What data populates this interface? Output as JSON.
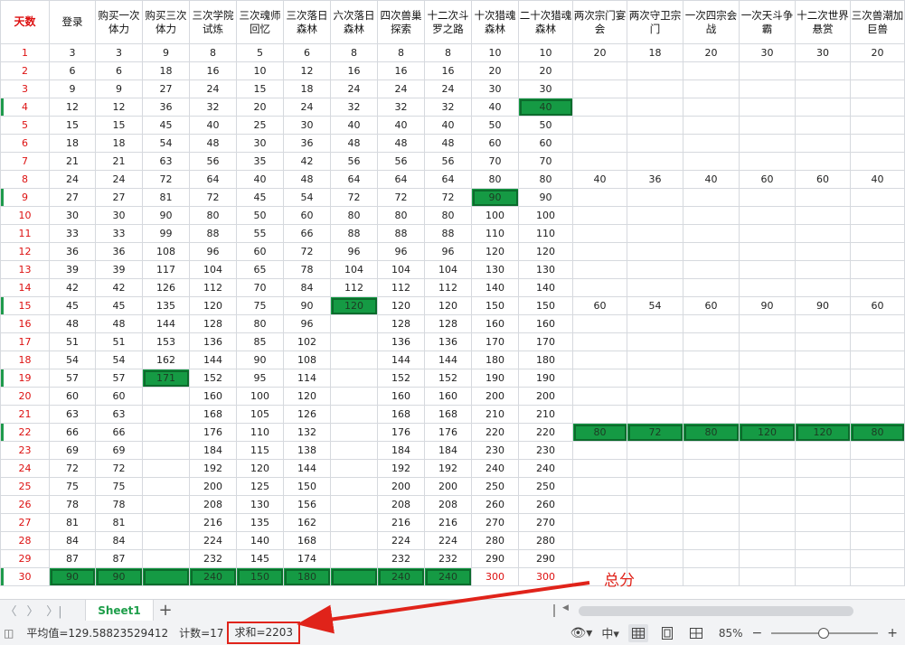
{
  "sheet": {
    "headers": [
      "天数",
      "登录",
      "购买一次体力",
      "购买三次体力",
      "三次学院试炼",
      "三次魂师回忆",
      "三次落日森林",
      "六次落日森林",
      "四次兽巢探索",
      "十二次斗罗之路",
      "十次猎魂森林",
      "二十次猎魂森林",
      "两次宗门宴会",
      "两次守卫宗门",
      "一次四宗会战",
      "一次天斗争霸",
      "十二次世界悬赏",
      "三次兽潮加巨兽"
    ],
    "rows": [
      [
        "1",
        "3",
        "3",
        "9",
        "8",
        "5",
        "6",
        "8",
        "8",
        "8",
        "10",
        "10",
        "20",
        "18",
        "20",
        "30",
        "30",
        "20"
      ],
      [
        "2",
        "6",
        "6",
        "18",
        "16",
        "10",
        "12",
        "16",
        "16",
        "16",
        "20",
        "20",
        "",
        "",
        "",
        "",
        "",
        ""
      ],
      [
        "3",
        "9",
        "9",
        "27",
        "24",
        "15",
        "18",
        "24",
        "24",
        "24",
        "30",
        "30",
        "",
        "",
        "",
        "",
        "",
        ""
      ],
      [
        "4",
        "12",
        "12",
        "36",
        "32",
        "20",
        "24",
        "32",
        "32",
        "32",
        "40",
        "40",
        "",
        "",
        "",
        "",
        "",
        ""
      ],
      [
        "5",
        "15",
        "15",
        "45",
        "40",
        "25",
        "30",
        "40",
        "40",
        "40",
        "50",
        "50",
        "",
        "",
        "",
        "",
        "",
        ""
      ],
      [
        "6",
        "18",
        "18",
        "54",
        "48",
        "30",
        "36",
        "48",
        "48",
        "48",
        "60",
        "60",
        "",
        "",
        "",
        "",
        "",
        ""
      ],
      [
        "7",
        "21",
        "21",
        "63",
        "56",
        "35",
        "42",
        "56",
        "56",
        "56",
        "70",
        "70",
        "",
        "",
        "",
        "",
        "",
        ""
      ],
      [
        "8",
        "24",
        "24",
        "72",
        "64",
        "40",
        "48",
        "64",
        "64",
        "64",
        "80",
        "80",
        "40",
        "36",
        "40",
        "60",
        "60",
        "40"
      ],
      [
        "9",
        "27",
        "27",
        "81",
        "72",
        "45",
        "54",
        "72",
        "72",
        "72",
        "90",
        "90",
        "",
        "",
        "",
        "",
        "",
        ""
      ],
      [
        "10",
        "30",
        "30",
        "90",
        "80",
        "50",
        "60",
        "80",
        "80",
        "80",
        "100",
        "100",
        "",
        "",
        "",
        "",
        "",
        ""
      ],
      [
        "11",
        "33",
        "33",
        "99",
        "88",
        "55",
        "66",
        "88",
        "88",
        "88",
        "110",
        "110",
        "",
        "",
        "",
        "",
        "",
        ""
      ],
      [
        "12",
        "36",
        "36",
        "108",
        "96",
        "60",
        "72",
        "96",
        "96",
        "96",
        "120",
        "120",
        "",
        "",
        "",
        "",
        "",
        ""
      ],
      [
        "13",
        "39",
        "39",
        "117",
        "104",
        "65",
        "78",
        "104",
        "104",
        "104",
        "130",
        "130",
        "",
        "",
        "",
        "",
        "",
        ""
      ],
      [
        "14",
        "42",
        "42",
        "126",
        "112",
        "70",
        "84",
        "112",
        "112",
        "112",
        "140",
        "140",
        "",
        "",
        "",
        "",
        "",
        ""
      ],
      [
        "15",
        "45",
        "45",
        "135",
        "120",
        "75",
        "90",
        "120",
        "120",
        "120",
        "150",
        "150",
        "60",
        "54",
        "60",
        "90",
        "90",
        "60"
      ],
      [
        "16",
        "48",
        "48",
        "144",
        "128",
        "80",
        "96",
        "",
        "128",
        "128",
        "160",
        "160",
        "",
        "",
        "",
        "",
        "",
        ""
      ],
      [
        "17",
        "51",
        "51",
        "153",
        "136",
        "85",
        "102",
        "",
        "136",
        "136",
        "170",
        "170",
        "",
        "",
        "",
        "",
        "",
        ""
      ],
      [
        "18",
        "54",
        "54",
        "162",
        "144",
        "90",
        "108",
        "",
        "144",
        "144",
        "180",
        "180",
        "",
        "",
        "",
        "",
        "",
        ""
      ],
      [
        "19",
        "57",
        "57",
        "171",
        "152",
        "95",
        "114",
        "",
        "152",
        "152",
        "190",
        "190",
        "",
        "",
        "",
        "",
        "",
        ""
      ],
      [
        "20",
        "60",
        "60",
        "",
        "160",
        "100",
        "120",
        "",
        "160",
        "160",
        "200",
        "200",
        "",
        "",
        "",
        "",
        "",
        ""
      ],
      [
        "21",
        "63",
        "63",
        "",
        "168",
        "105",
        "126",
        "",
        "168",
        "168",
        "210",
        "210",
        "",
        "",
        "",
        "",
        "",
        ""
      ],
      [
        "22",
        "66",
        "66",
        "",
        "176",
        "110",
        "132",
        "",
        "176",
        "176",
        "220",
        "220",
        "80",
        "72",
        "80",
        "120",
        "120",
        "80"
      ],
      [
        "23",
        "69",
        "69",
        "",
        "184",
        "115",
        "138",
        "",
        "184",
        "184",
        "230",
        "230",
        "",
        "",
        "",
        "",
        "",
        ""
      ],
      [
        "24",
        "72",
        "72",
        "",
        "192",
        "120",
        "144",
        "",
        "192",
        "192",
        "240",
        "240",
        "",
        "",
        "",
        "",
        "",
        ""
      ],
      [
        "25",
        "75",
        "75",
        "",
        "200",
        "125",
        "150",
        "",
        "200",
        "200",
        "250",
        "250",
        "",
        "",
        "",
        "",
        "",
        ""
      ],
      [
        "26",
        "78",
        "78",
        "",
        "208",
        "130",
        "156",
        "",
        "208",
        "208",
        "260",
        "260",
        "",
        "",
        "",
        "",
        "",
        ""
      ],
      [
        "27",
        "81",
        "81",
        "",
        "216",
        "135",
        "162",
        "",
        "216",
        "216",
        "270",
        "270",
        "",
        "",
        "",
        "",
        "",
        ""
      ],
      [
        "28",
        "84",
        "84",
        "",
        "224",
        "140",
        "168",
        "",
        "224",
        "224",
        "280",
        "280",
        "",
        "",
        "",
        "",
        "",
        ""
      ],
      [
        "29",
        "87",
        "87",
        "",
        "232",
        "145",
        "174",
        "",
        "232",
        "232",
        "290",
        "290",
        "",
        "",
        "",
        "",
        "",
        ""
      ],
      [
        "30",
        "90",
        "90",
        "",
        "240",
        "150",
        "180",
        "",
        "240",
        "240",
        "300",
        "300",
        "",
        "",
        "",
        "",
        "",
        ""
      ]
    ],
    "highlighted_cells": [
      [
        3,
        11
      ],
      [
        8,
        10
      ],
      [
        14,
        7
      ],
      [
        18,
        3
      ],
      [
        21,
        12
      ],
      [
        21,
        13
      ],
      [
        21,
        14
      ],
      [
        21,
        15
      ],
      [
        21,
        16
      ],
      [
        21,
        17
      ],
      [
        29,
        1
      ],
      [
        29,
        2
      ],
      [
        29,
        3
      ],
      [
        29,
        4
      ],
      [
        29,
        5
      ],
      [
        29,
        6
      ],
      [
        29,
        7
      ],
      [
        29,
        8
      ],
      [
        29,
        9
      ]
    ],
    "red_cells": [
      [
        29,
        10
      ],
      [
        29,
        11
      ]
    ],
    "row_markers": [
      3,
      8,
      14,
      18,
      21,
      29
    ]
  },
  "tabs": {
    "sheet_name": "Sheet1",
    "add_label": "+"
  },
  "nav": {
    "first": "〈",
    "prev": "〉",
    "last": "〉|"
  },
  "status": {
    "average": "平均值=129.58823529412",
    "count": "计数=17",
    "sum": "求和=2203",
    "zoom": "85%",
    "zoom_minus": "−",
    "zoom_plus": "+"
  },
  "annotation": {
    "label": "总分",
    "color": "#e0231a"
  },
  "colors": {
    "highlight": "#159a44",
    "red_text": "#dd1111",
    "accent_green": "#1e9e4a"
  }
}
